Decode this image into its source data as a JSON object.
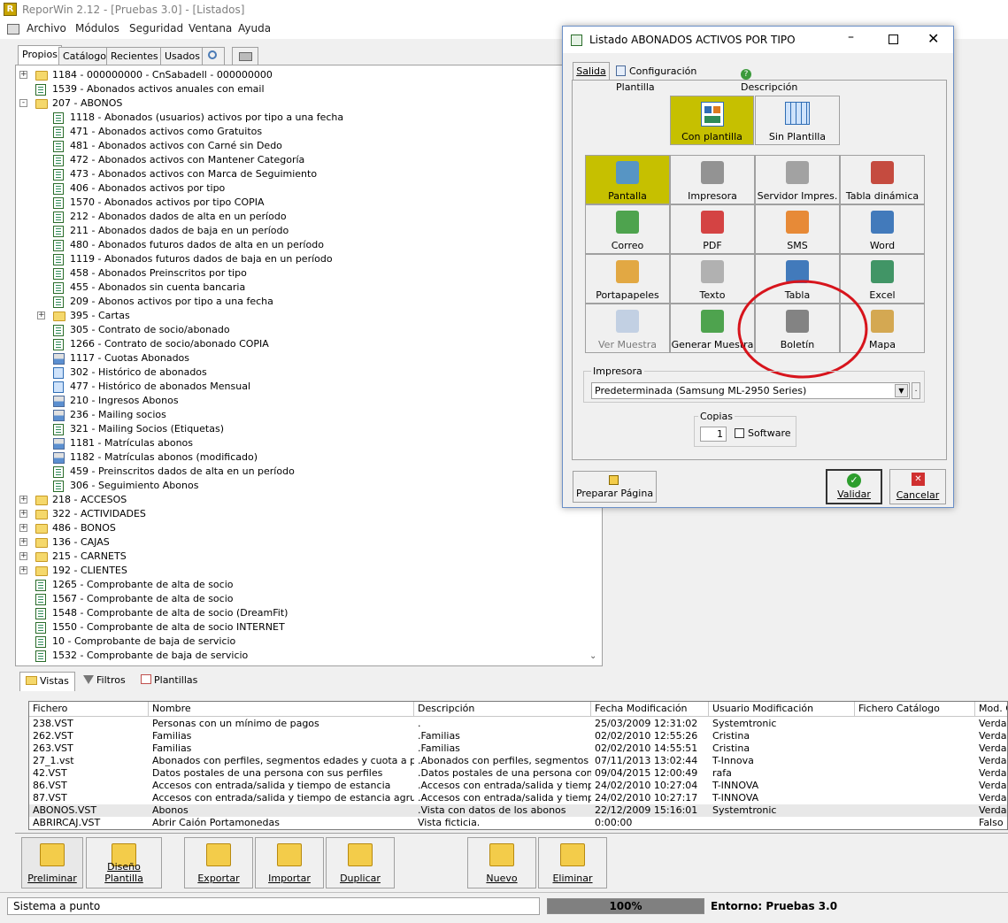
{
  "app": {
    "title": "ReporWin 2.12 - [Pruebas 3.0] - [Listados]"
  },
  "menu": [
    "Archivo",
    "Módulos",
    "Seguridad",
    "Ventana",
    "Ayuda"
  ],
  "left_tabs": [
    "Propios",
    "Catálogo",
    "Recientes",
    "Usados"
  ],
  "tree": [
    {
      "label": "1184 - 000000000 - CnSabadell - 000000000",
      "type": "folder",
      "level": 0,
      "expander": "+"
    },
    {
      "label": "1539 - Abonados activos anuales con email",
      "type": "doc",
      "level": 0
    },
    {
      "label": "207 - ABONOS",
      "type": "folder",
      "level": 0,
      "expander": "-"
    },
    {
      "label": "1118 - Abonados (usuarios)  activos por tipo a una fecha",
      "type": "doc",
      "level": 1
    },
    {
      "label": "471 - Abonados activos como Gratuitos",
      "type": "doc",
      "level": 1
    },
    {
      "label": "481 - Abonados activos con Carné sin Dedo",
      "type": "doc",
      "level": 1
    },
    {
      "label": "472 - Abonados activos con Mantener Categoría",
      "type": "doc",
      "level": 1
    },
    {
      "label": "473 - Abonados activos con Marca de Seguimiento",
      "type": "doc",
      "level": 1
    },
    {
      "label": "406 - Abonados activos por tipo",
      "type": "doc",
      "level": 1
    },
    {
      "label": "1570 - Abonados activos por tipo COPIA",
      "type": "doc",
      "level": 1
    },
    {
      "label": "212 - Abonados dados de alta en un período",
      "type": "doc",
      "level": 1
    },
    {
      "label": "211 - Abonados dados de baja en un período",
      "type": "doc",
      "level": 1
    },
    {
      "label": "480 - Abonados futuros dados de alta en un período",
      "type": "doc",
      "level": 1
    },
    {
      "label": "1119 - Abonados futuros dados de baja en un período",
      "type": "doc",
      "level": 1
    },
    {
      "label": "458 - Abonados Preinscritos por tipo",
      "type": "doc",
      "level": 1
    },
    {
      "label": "455 - Abonados sin cuenta bancaria",
      "type": "doc",
      "level": 1
    },
    {
      "label": "209 - Abonos activos por tipo a una fecha",
      "type": "doc",
      "level": 1
    },
    {
      "label": "395 - Cartas",
      "type": "folder",
      "level": 1,
      "expander": "+"
    },
    {
      "label": "305 - Contrato de socio/abonado",
      "type": "doc",
      "level": 1
    },
    {
      "label": "1266 - Contrato de socio/abonado COPIA",
      "type": "doc",
      "level": 1
    },
    {
      "label": "1117 - Cuotas Abonados",
      "type": "print",
      "level": 1
    },
    {
      "label": "302 - Histórico de abonados",
      "type": "blue",
      "level": 1
    },
    {
      "label": "477 - Histórico de abonados Mensual",
      "type": "blue",
      "level": 1
    },
    {
      "label": "210 - Ingresos Abonos",
      "type": "print",
      "level": 1
    },
    {
      "label": "236 - Mailing socios",
      "type": "print",
      "level": 1
    },
    {
      "label": "321 - Mailing Socios (Etiquetas)",
      "type": "doc",
      "level": 1
    },
    {
      "label": "1181 - Matrículas abonos",
      "type": "print",
      "level": 1
    },
    {
      "label": "1182 - Matrículas abonos (modificado)",
      "type": "print",
      "level": 1
    },
    {
      "label": "459 - Preinscritos dados de alta en un período",
      "type": "doc",
      "level": 1
    },
    {
      "label": "306 - Seguimiento Abonos",
      "type": "doc",
      "level": 1
    },
    {
      "label": "218 - ACCESOS",
      "type": "folder",
      "level": 0,
      "expander": "+"
    },
    {
      "label": "322 - ACTIVIDADES",
      "type": "folder",
      "level": 0,
      "expander": "+"
    },
    {
      "label": "486 - BONOS",
      "type": "folder",
      "level": 0,
      "expander": "+"
    },
    {
      "label": "136 - CAJAS",
      "type": "folder",
      "level": 0,
      "expander": "+"
    },
    {
      "label": "215 - CARNETS",
      "type": "folder",
      "level": 0,
      "expander": "+"
    },
    {
      "label": "192 - CLIENTES",
      "type": "folder",
      "level": 0,
      "expander": "+"
    },
    {
      "label": "1265 - Comprobante de alta de socio",
      "type": "doc",
      "level": 0
    },
    {
      "label": "1567 - Comprobante de alta de socio",
      "type": "doc",
      "level": 0
    },
    {
      "label": "1548 - Comprobante de alta de socio (DreamFit)",
      "type": "doc",
      "level": 0
    },
    {
      "label": "1550 - Comprobante de alta de socio INTERNET",
      "type": "doc",
      "level": 0
    },
    {
      "label": "10 - Comprobante de baja de servicio",
      "type": "doc",
      "level": 0
    },
    {
      "label": "1532 - Comprobante de baja de servicio",
      "type": "doc",
      "level": 0
    }
  ],
  "bottom_tabs": [
    "Vistas",
    "Filtros",
    "Plantillas"
  ],
  "grid": {
    "columns": [
      "Fichero",
      "Nombre",
      "Descripción",
      "Fecha Modificación",
      "Usuario Modificación",
      "Fichero Catálogo",
      "Mod. C"
    ],
    "rows": [
      [
        "238.VST",
        "Personas con un mínimo de pagos",
        ".",
        "25/03/2009 12:31:02",
        "Systemtronic",
        "",
        "Verdad"
      ],
      [
        "262.VST",
        "Familias",
        ".Familias",
        "02/02/2010 12:55:26",
        "Cristina",
        "",
        "Verdad"
      ],
      [
        "263.VST",
        "Familias",
        ".Familias",
        "02/02/2010 14:55:51",
        "Cristina",
        "",
        "Verdad"
      ],
      [
        "27_1.vst",
        "Abonados con perfiles, segmentos edades y cuota a pagar",
        ".Abonados con perfiles, segmentos e...",
        "07/11/2013 13:02:44",
        "T-Innova",
        "",
        "Verdad"
      ],
      [
        "42.VST",
        "Datos postales de una persona con sus perfiles",
        ".Datos postales de una persona con s...",
        "09/04/2015 12:00:49",
        "rafa",
        "",
        "Verdad"
      ],
      [
        "86.VST",
        "Accesos con entrada/salida y tiempo de estancia",
        ".Accesos con entrada/salida y tiempo...",
        "24/02/2010 10:27:04",
        "T-INNOVA",
        "",
        "Verdad"
      ],
      [
        "87.VST",
        "Accesos con entrada/salida y tiempo de estancia agrupad...",
        ".Accesos con entrada/salida y tiempo...",
        "24/02/2010 10:27:17",
        "T-INNOVA",
        "",
        "Verdad"
      ],
      [
        "ABONOS.VST",
        "Abonos",
        ".Vista con datos de los abonos",
        "22/12/2009 15:16:01",
        "Systemtronic",
        "",
        "Verdad"
      ],
      [
        "ABRIRCAJ.VST",
        "Abrir Caión Portamonedas",
        "Vista ficticia.",
        "0:00:00",
        "",
        "",
        "Falso"
      ]
    ]
  },
  "toolbar": [
    "Preliminar",
    "Diseño Plantilla",
    "Exportar",
    "Importar",
    "Duplicar",
    "Nuevo",
    "Eliminar"
  ],
  "status": {
    "text": "Sistema a punto",
    "progress": "100%",
    "progress_value": 1.0,
    "env": "Entorno: Pruebas 3.0"
  },
  "dialog": {
    "title": "Listado ABONADOS ACTIVOS POR TIPO",
    "tabs": [
      "Salida",
      "Configuración Plantilla",
      "Descripción"
    ],
    "template_opts": [
      "Con plantilla",
      "Sin Plantilla"
    ],
    "outputs": [
      "Pantalla",
      "Impresora",
      "Servidor Impres.",
      "Tabla dinámica",
      "Correo",
      "PDF",
      "SMS",
      "Word",
      "Portapapeles",
      "Texto",
      "Tabla",
      "Excel",
      "Ver Muestra",
      "Generar  Muestra",
      "Boletín",
      "Mapa"
    ],
    "printer_label": "Impresora",
    "printer_value": "Predeterminada (Samsung ML-2950 Series)",
    "copies_label": "Copias",
    "copies_value": "1",
    "software_label": "Software",
    "prepare_button": "Preparar Página",
    "validate_button": "Validar",
    "cancel_button": "Cancelar",
    "highlight_color": "#d7141c",
    "selected_color": "#c6c000"
  }
}
